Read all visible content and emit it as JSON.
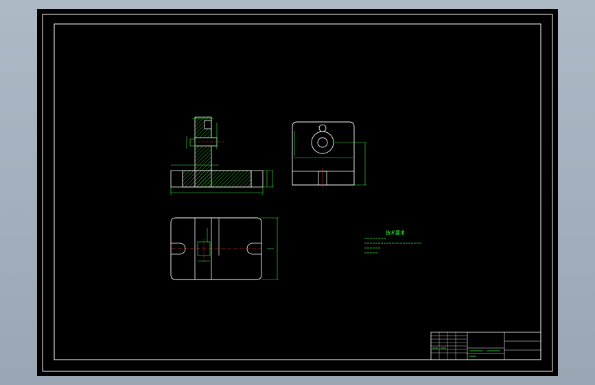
{
  "colors": {
    "background": "#000000",
    "frame": "#ffffff",
    "dimension": "#33ff33",
    "centerline": "#ff3333",
    "hatch": "#33ff33",
    "outline": "#ffffff"
  },
  "drawing": {
    "views": [
      "front-section-view",
      "side-view",
      "top-view"
    ],
    "front_view": {
      "dim_overall_width": "",
      "dim_height": ""
    },
    "technical_requirements": {
      "title": "技术要求",
      "lines": [
        "",
        "",
        "",
        ""
      ]
    },
    "title_block": {
      "rows": 6
    }
  }
}
